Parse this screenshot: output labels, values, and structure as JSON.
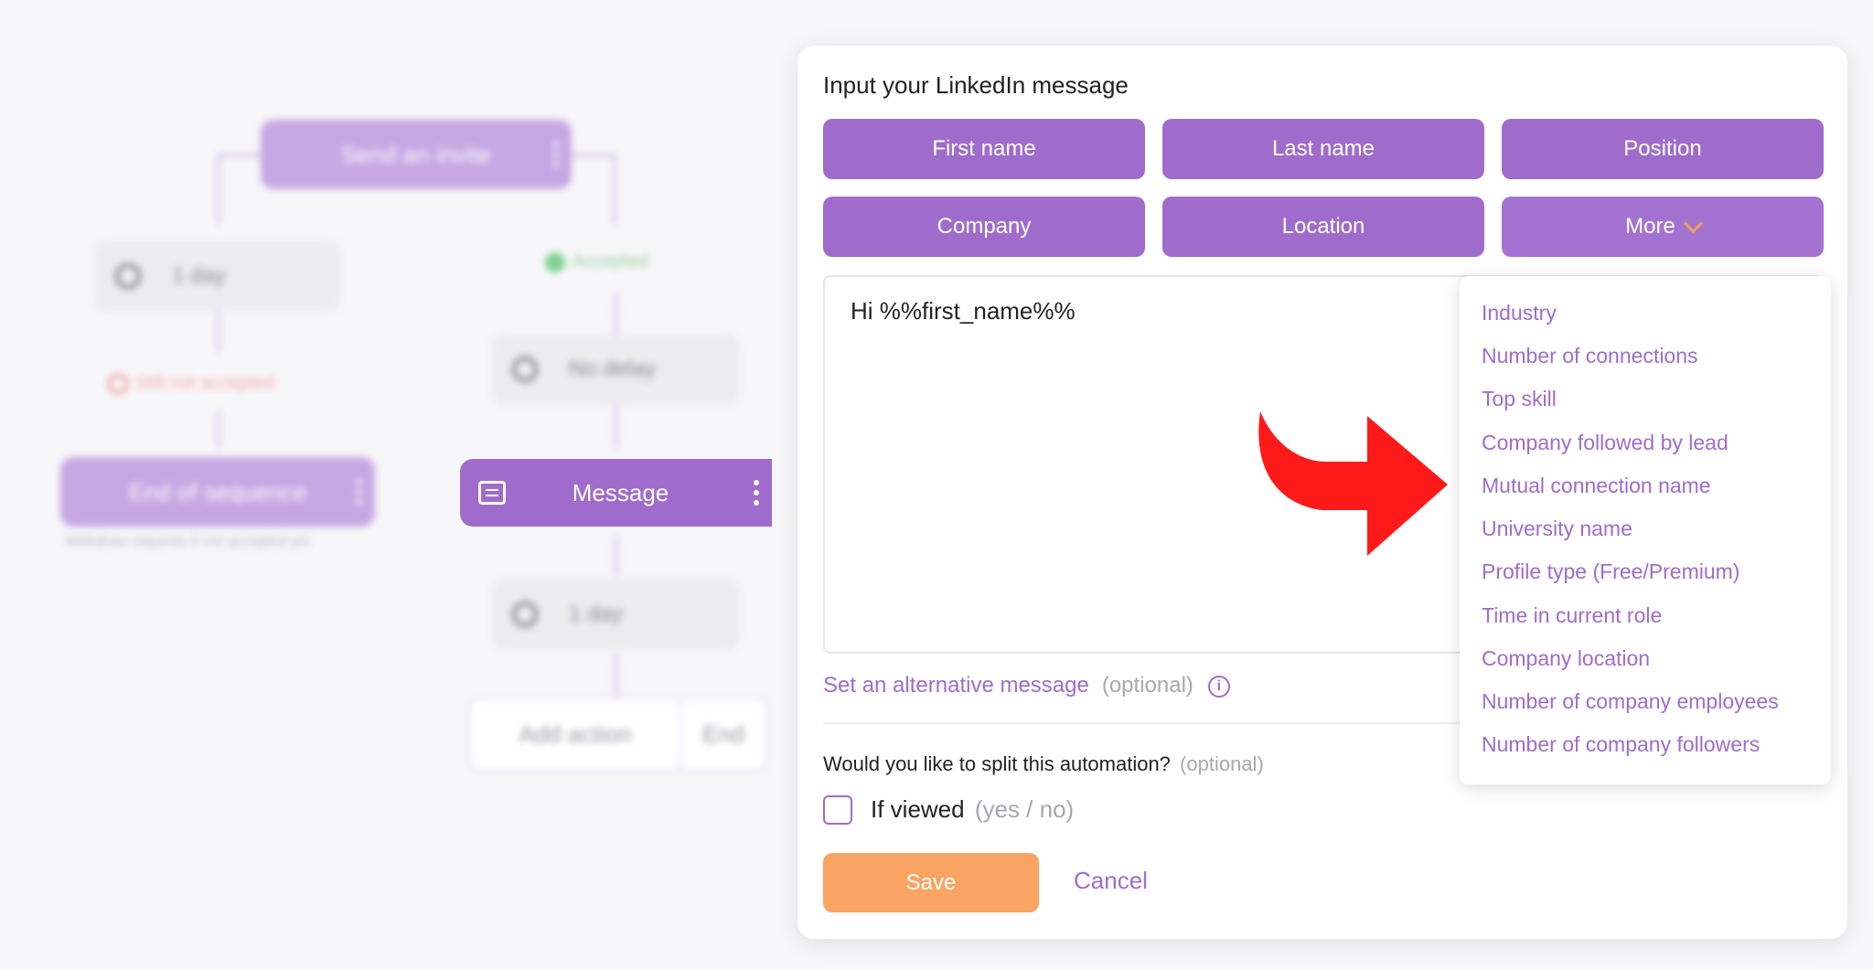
{
  "workflow": {
    "send_invite": "Send an invite",
    "delay_left": "1 day",
    "accepted": "Accepted",
    "not_accepted": "Still not accepted",
    "no_delay": "No delay",
    "end_of_sequence": "End of sequence",
    "withdraw_note": "Withdraw requests if not accepted yet",
    "message": "Message",
    "delay_bottom": "1 day",
    "add_action": "Add action",
    "end": "End"
  },
  "panel": {
    "title": "Input your LinkedIn message",
    "variables": [
      "First name",
      "Last name",
      "Position",
      "Company",
      "Location"
    ],
    "more": "More",
    "message_text": "Hi %%first_name%%",
    "alt_message": "Set an alternative message",
    "alt_optional": "(optional)",
    "split_question": "Would you like to split this automation?",
    "split_optional": "(optional)",
    "if_viewed": "If viewed",
    "if_viewed_hint": "(yes / no)",
    "save": "Save",
    "cancel": "Cancel"
  },
  "dropdown": {
    "items": [
      "Industry",
      "Number of connections",
      "Top skill",
      "Company followed by lead",
      "Mutual connection name",
      "University name",
      "Profile type (Free/Premium)",
      "Time in current role",
      "Company location",
      "Number of company employees",
      "Number of company followers"
    ]
  },
  "colors": {
    "accent": "#9f6ccb",
    "save": "#f9a463",
    "arrow": "#ff1a1a"
  }
}
